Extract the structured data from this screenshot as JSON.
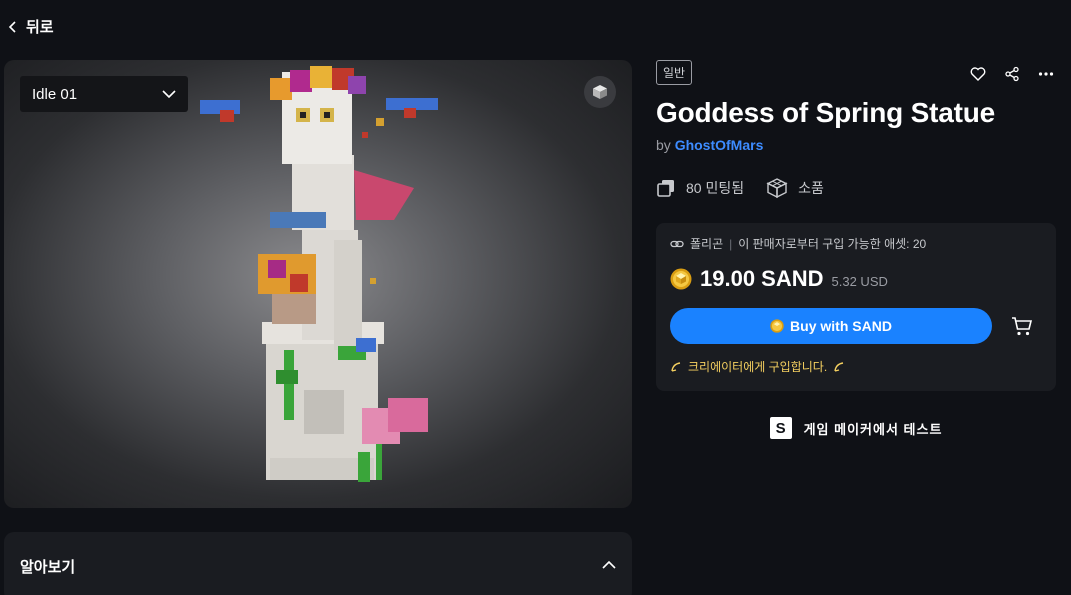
{
  "nav": {
    "back_label": "뒤로"
  },
  "viewer": {
    "animation_selected": "Idle 01"
  },
  "learn_more": {
    "title": "알아보기"
  },
  "asset": {
    "rarity_badge": "일반",
    "title": "Goddess of Spring Statue",
    "by_prefix": "by",
    "creator": "GhostOfMars",
    "minted": "80 민팅됨",
    "category": "소품"
  },
  "purchase": {
    "info_type": "폴리곤",
    "info_separator": "|",
    "info_available": "이 판매자로부터 구입 가능한 애셋: 20",
    "price": "19.00 SAND",
    "price_usd": "5.32 USD",
    "buy_label": "Buy with SAND",
    "creator_note": "크리에이터에게 구입합니다."
  },
  "game_maker": {
    "label": "게임 메이커에서 테스트",
    "logo_letter": "S"
  },
  "colors": {
    "accent": "#1a82ff",
    "link": "#3d8cff",
    "note": "#f5d060",
    "background": "#0f1116",
    "card": "#1a1c21"
  }
}
